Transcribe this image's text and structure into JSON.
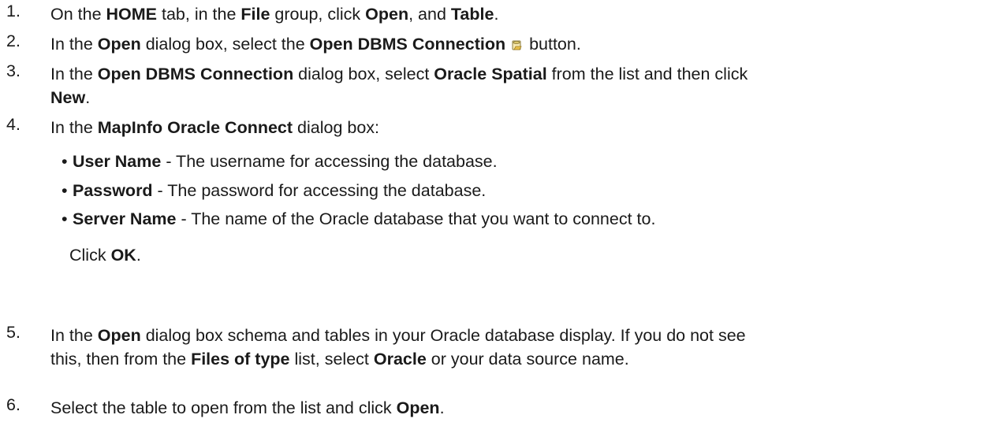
{
  "steps": [
    {
      "num": "1.",
      "parts": [
        "On the ",
        "HOME",
        " tab, in the ",
        "File",
        " group, click ",
        "Open",
        ", and ",
        "Table",
        "."
      ]
    },
    {
      "num": "2.",
      "parts": [
        "In the ",
        "Open",
        " dialog box, select the ",
        "Open DBMS Connection",
        " button."
      ],
      "icon": "open-dbms-connection-icon"
    },
    {
      "num": "3.",
      "line1": [
        "In the ",
        "Open DBMS Connection",
        " dialog box, select ",
        "Oracle Spatial",
        " from the list and then click"
      ],
      "line2": [
        "New",
        "."
      ]
    },
    {
      "num": "4.",
      "parts": [
        "In the ",
        "MapInfo Oracle Connect",
        " dialog box:"
      ],
      "bullets": [
        {
          "term": "User Name",
          "desc": " - The username for accessing the database."
        },
        {
          "term": "Password",
          "desc": " - The password for accessing the database."
        },
        {
          "term": "Server Name",
          "desc": " - The name of the Oracle database that you want to connect to."
        }
      ],
      "click": [
        "Click ",
        "OK",
        "."
      ]
    },
    {
      "num": "5.",
      "line1": [
        "In the ",
        "Open",
        " dialog box schema and tables in your Oracle database display. If you do not see"
      ],
      "line2": [
        "this, then from the ",
        "Files of type",
        " list, select ",
        "Oracle",
        " or your data source name."
      ]
    },
    {
      "num": "6.",
      "parts": [
        "Select the table to open from the list and click ",
        "Open",
        "."
      ]
    }
  ],
  "bullet_char": "•"
}
